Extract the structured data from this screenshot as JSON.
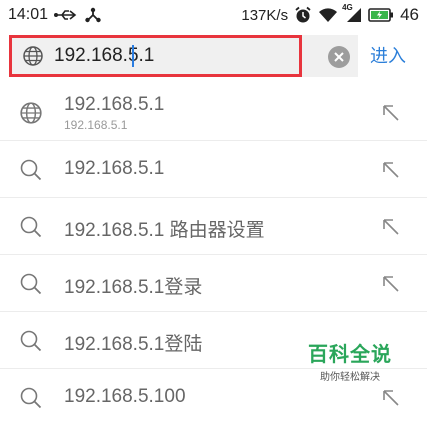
{
  "status_bar": {
    "time": "14:01",
    "net_speed": "137K/s",
    "network_type": "4G",
    "battery": "46",
    "icons": [
      "usb-icon",
      "share-icon",
      "alarm-icon",
      "wifi-icon",
      "signal-icon",
      "battery-charging-icon"
    ]
  },
  "address_bar": {
    "value": "192.168.5.1",
    "go_label": "进入",
    "icons": [
      "globe-icon",
      "clear-icon"
    ]
  },
  "suggestions": [
    {
      "icon": "globe-icon",
      "text": "192.168.5.1",
      "sub": "192.168.5.1"
    },
    {
      "icon": "search-icon",
      "text": "192.168.5.1"
    },
    {
      "icon": "search-icon",
      "text": "192.168.5.1 路由器设置"
    },
    {
      "icon": "search-icon",
      "text": "192.168.5.1登录"
    },
    {
      "icon": "search-icon",
      "text": "192.168.5.1登陆"
    },
    {
      "icon": "search-icon",
      "text": "192.168.5.100"
    }
  ],
  "watermark": {
    "title": "百科全说",
    "subtitle": "助你轻松解决"
  },
  "colors": {
    "highlight_border": "#e8343d",
    "accent_blue": "#2c7fd9",
    "watermark_green": "#2aa65a"
  }
}
